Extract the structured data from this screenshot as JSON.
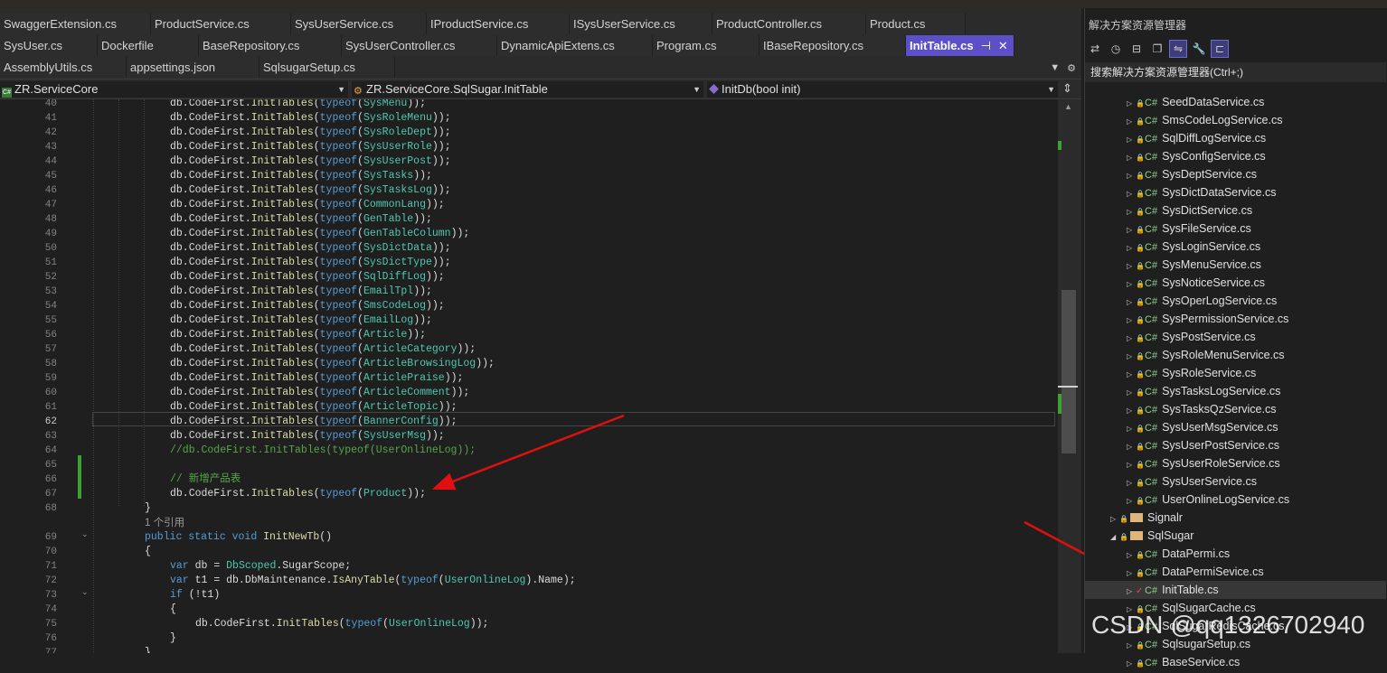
{
  "tabs": {
    "row1": [
      "SwaggerExtension.cs",
      "ProductService.cs",
      "SysUserService.cs",
      "IProductService.cs",
      "ISysUserService.cs",
      "ProductController.cs",
      "Product.cs"
    ],
    "row2": [
      "SysUser.cs",
      "Dockerfile",
      "BaseRepository.cs",
      "SysUserController.cs",
      "DynamicApiExtens.cs",
      "Program.cs",
      "IBaseRepository.cs"
    ],
    "active": "InitTable.cs",
    "active_pin": "⊣",
    "active_close": "✕",
    "row3": [
      "AssemblyUtils.cs",
      "appsettings.json",
      "SqlsugarSetup.cs"
    ]
  },
  "navbar": {
    "project": "ZR.ServiceCore",
    "class": "ZR.ServiceCore.SqlSugar.InitTable",
    "member": "InitDb(bool init)"
  },
  "editor": {
    "line_numbers": [
      "40",
      "41",
      "42",
      "43",
      "44",
      "45",
      "46",
      "47",
      "48",
      "49",
      "50",
      "51",
      "52",
      "53",
      "54",
      "55",
      "56",
      "57",
      "58",
      "59",
      "60",
      "61",
      "62",
      "63",
      "64",
      "65",
      "66",
      "67",
      "68",
      "",
      "69",
      "70",
      "71",
      "72",
      "73",
      "74",
      "75",
      "76",
      "77"
    ],
    "init_types": [
      "SysMenu",
      "SysRoleMenu",
      "SysRoleDept",
      "SysUserRole",
      "SysUserPost",
      "SysTasks",
      "SysTasksLog",
      "CommonLang",
      "GenTable",
      "GenTableColumn",
      "SysDictData",
      "SysDictType",
      "SqlDiffLog",
      "EmailTpl",
      "SmsCodeLog",
      "EmailLog",
      "Article",
      "ArticleCategory",
      "ArticleBrowsingLog",
      "ArticlePraise",
      "ArticleComment",
      "ArticleTopic",
      "BannerConfig",
      "SysUserMsg"
    ],
    "commented_line": "//db.CodeFirst.InitTables(typeof(UserOnlineLog));",
    "comment_new_table": "// 新增产品表",
    "product_type": "Product",
    "ref_hint": "1 个引用",
    "method_name": "InitNewTb",
    "db_var_type": "DbScoped",
    "db_var_prop": "SugarScope",
    "maint_method": "IsAnyTable",
    "online_type": "UserOnlineLog"
  },
  "solution_explorer": {
    "title": "解决方案资源管理器",
    "search_placeholder": "搜索解决方案资源管理器(Ctrl+;)",
    "cs_badge": "C#",
    "items": [
      {
        "label": "SeedDataService.cs",
        "kind": "cs"
      },
      {
        "label": "SmsCodeLogService.cs",
        "kind": "cs"
      },
      {
        "label": "SqlDiffLogService.cs",
        "kind": "cs"
      },
      {
        "label": "SysConfigService.cs",
        "kind": "cs"
      },
      {
        "label": "SysDeptService.cs",
        "kind": "cs"
      },
      {
        "label": "SysDictDataService.cs",
        "kind": "cs"
      },
      {
        "label": "SysDictService.cs",
        "kind": "cs"
      },
      {
        "label": "SysFileService.cs",
        "kind": "cs"
      },
      {
        "label": "SysLoginService.cs",
        "kind": "cs"
      },
      {
        "label": "SysMenuService.cs",
        "kind": "cs"
      },
      {
        "label": "SysNoticeService.cs",
        "kind": "cs"
      },
      {
        "label": "SysOperLogService.cs",
        "kind": "cs"
      },
      {
        "label": "SysPermissionService.cs",
        "kind": "cs"
      },
      {
        "label": "SysPostService.cs",
        "kind": "cs"
      },
      {
        "label": "SysRoleMenuService.cs",
        "kind": "cs"
      },
      {
        "label": "SysRoleService.cs",
        "kind": "cs"
      },
      {
        "label": "SysTasksLogService.cs",
        "kind": "cs"
      },
      {
        "label": "SysTasksQzService.cs",
        "kind": "cs"
      },
      {
        "label": "SysUserMsgService.cs",
        "kind": "cs"
      },
      {
        "label": "SysUserPostService.cs",
        "kind": "cs"
      },
      {
        "label": "SysUserRoleService.cs",
        "kind": "cs"
      },
      {
        "label": "SysUserService.cs",
        "kind": "cs"
      },
      {
        "label": "UserOnlineLogService.cs",
        "kind": "cs"
      },
      {
        "label": "Signalr",
        "kind": "folder"
      },
      {
        "label": "SqlSugar",
        "kind": "folder-open"
      },
      {
        "label": "DataPermi.cs",
        "kind": "cs"
      },
      {
        "label": "DataPermiSevice.cs",
        "kind": "cs"
      },
      {
        "label": "InitTable.cs",
        "kind": "cs-selected"
      },
      {
        "label": "SqlSugarCache.cs",
        "kind": "cs"
      },
      {
        "label": "SqlSugarRedisCache.cs",
        "kind": "cs"
      },
      {
        "label": "SqlsugarSetup.cs",
        "kind": "cs"
      },
      {
        "label": "BaseService.cs",
        "kind": "cs"
      }
    ]
  },
  "watermark": "CSDN @qq1326702940",
  "colors": {
    "active_tab": "#5c50c8",
    "keyword": "#569cd6",
    "type": "#4ec9b0",
    "method": "#dcdcaa",
    "comment": "#57a64a",
    "annotation_arrow": "#e01010"
  }
}
